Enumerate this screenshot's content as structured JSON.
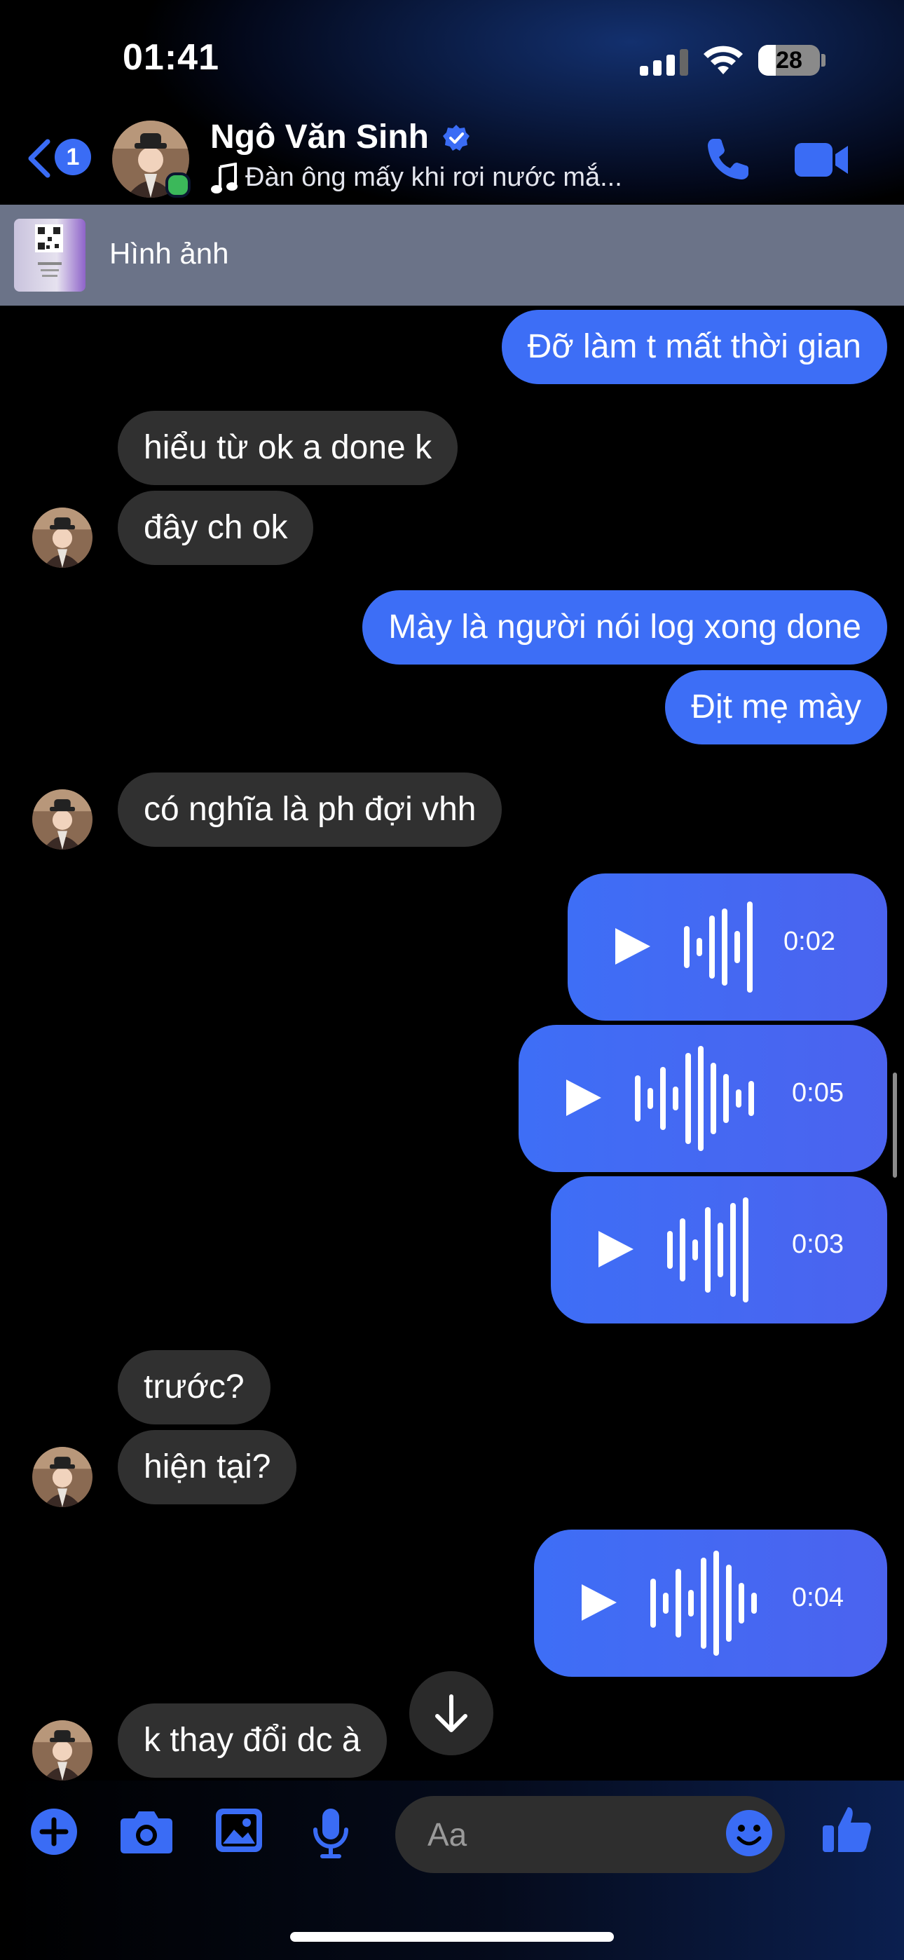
{
  "status_bar": {
    "time": "01:41",
    "battery": "28",
    "battery_level": 0.28
  },
  "header": {
    "back_badge": "1",
    "contact_name": "Ngô Văn Sinh",
    "subtitle": "Đàn ông mấy khi rơi nước mắ...",
    "online": true
  },
  "pinned": {
    "label": "Hình ảnh"
  },
  "messages": [
    {
      "dir": "out",
      "text": "Đỡ làm t mất thời gian"
    },
    {
      "dir": "in",
      "text": "hiểu từ ok a done k"
    },
    {
      "dir": "in",
      "text": "đây ch ok"
    },
    {
      "dir": "out",
      "text": "Mày là người nói log xong done"
    },
    {
      "dir": "out",
      "text": "Địt mẹ mày"
    },
    {
      "dir": "in",
      "text": "có nghĩa là ph đợi vhh"
    },
    {
      "dir": "out",
      "type": "voice",
      "duration": "0:02"
    },
    {
      "dir": "out",
      "type": "voice",
      "duration": "0:05"
    },
    {
      "dir": "out",
      "type": "voice",
      "duration": "0:03"
    },
    {
      "dir": "in",
      "text": "trước?"
    },
    {
      "dir": "in",
      "text": "hiện tại?"
    },
    {
      "dir": "out",
      "type": "voice",
      "duration": "0:04"
    },
    {
      "dir": "in",
      "text": "k thay đổi dc à"
    }
  ],
  "composer": {
    "placeholder": "Aa"
  },
  "icons": [
    "back-arrow-icon",
    "verified-badge-icon",
    "music-note-icon",
    "phone-icon",
    "video-camera-icon",
    "play-icon",
    "arrow-down-icon",
    "plus-icon",
    "camera-icon",
    "image-icon",
    "microphone-icon",
    "emoji-icon",
    "thumbs-up-icon"
  ],
  "colors": {
    "outgoing_bubble": "#3d6ef6",
    "incoming_bubble": "#303030",
    "accent": "#3a6cf5",
    "online": "#3bb85a"
  }
}
